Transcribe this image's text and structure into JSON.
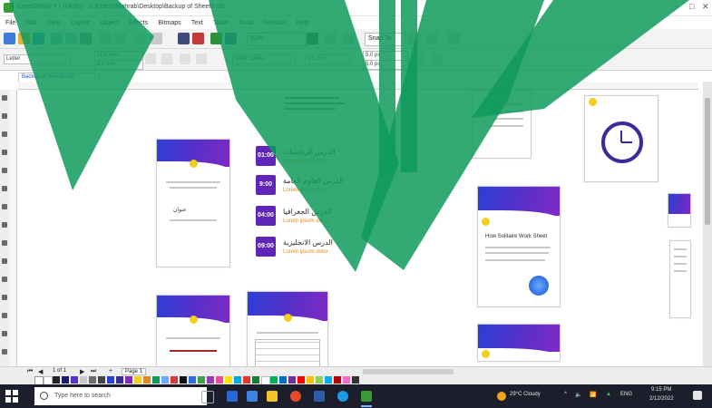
{
  "window": {
    "title": "CorelDRAW X7 (64-Bit) - C:\\Users\\Mehrab\\Desktop\\Backup of Sheet6.cdr",
    "minimize": "–",
    "maximize": "□",
    "close": "✕"
  },
  "menu": [
    "File",
    "Edit",
    "View",
    "Layout",
    "Object",
    "Effects",
    "Bitmaps",
    "Text",
    "Table",
    "Tools",
    "Window",
    "Help"
  ],
  "toolbar": {
    "zoom": "92%",
    "snap_to": "Snap To"
  },
  "propbar": {
    "preset": "Letter",
    "width": "11.0 mm",
    "height": "8.5 mm",
    "units": "Units: pixels",
    "nudge": "0.1 mm",
    "dup_x": "5.0 px",
    "dup_y": "5.0 px"
  },
  "document_tab": "Backup of Sheet6.cdr",
  "schedule": [
    {
      "time": "01:00",
      "title": "الدرس الرياضيات",
      "sub": "Lorem ipsum dolor"
    },
    {
      "time": "9:00",
      "title": "الدرس العلوم العامة",
      "sub": "Lorem ipsum dolor"
    },
    {
      "time": "04:00",
      "title": "الدرس الجغرافيا",
      "sub": "Lorem ipsum dolor"
    },
    {
      "time": "09:00",
      "title": "الدرس الانجليزية",
      "sub": "Lorem ipsum dolor"
    }
  ],
  "cards": {
    "left_heading": "عنوان",
    "right_heading": "How Solitaire Work Sheet"
  },
  "bottom": {
    "page_count": "1 of 1",
    "page_label": "Page 1"
  },
  "taskbar": {
    "search_placeholder": "Type here to search",
    "weather": "29°C Cloudy",
    "language": "ENG",
    "time": "9:15 PM",
    "date": "2/12/2022"
  },
  "colors": {
    "accent_purple": "#5e25b7",
    "header_blue": "#2b3fd6",
    "yellow_dot": "#f2cf1c",
    "watermark_green": "#0f9a5c"
  }
}
